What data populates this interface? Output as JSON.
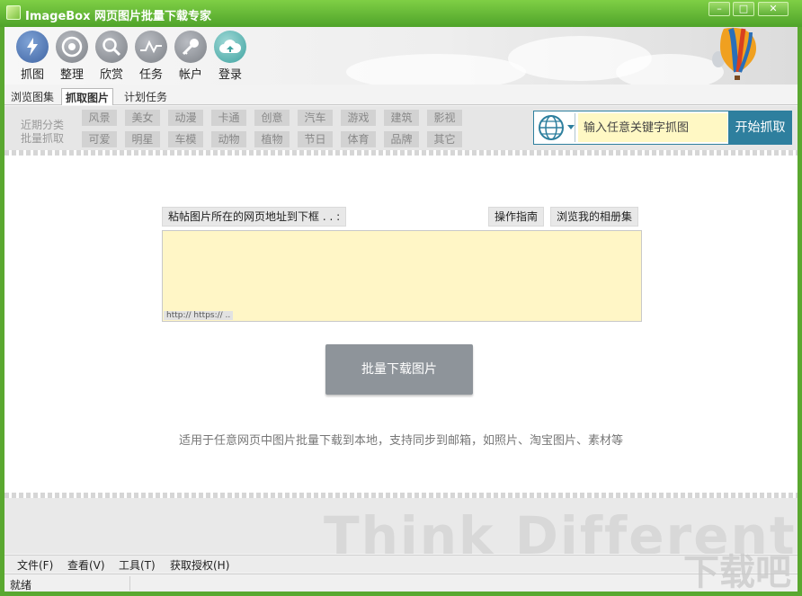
{
  "window": {
    "title": "ImageBox 网页图片批量下载专家",
    "controls": [
      "–",
      "□",
      "✕"
    ]
  },
  "toolbar": {
    "items": [
      {
        "label": "抓图",
        "icon": "lightning-icon"
      },
      {
        "label": "整理",
        "icon": "eye-icon"
      },
      {
        "label": "欣赏",
        "icon": "magnifier-icon"
      },
      {
        "label": "任务",
        "icon": "pulse-icon"
      },
      {
        "label": "帐户",
        "icon": "key-icon"
      },
      {
        "label": "登录",
        "icon": "cloud-upload-icon"
      }
    ]
  },
  "tabs": [
    "浏览图集",
    "抓取图片",
    "计划任务"
  ],
  "categories": {
    "label_line1": "近期分类",
    "label_line2": "批量抓取",
    "row1": [
      "风景",
      "美女",
      "动漫",
      "卡通",
      "创意",
      "汽车",
      "游戏",
      "建筑",
      "影视"
    ],
    "row2": [
      "可爱",
      "明星",
      "车模",
      "动物",
      "植物",
      "节日",
      "体育",
      "品牌",
      "其它"
    ]
  },
  "search": {
    "placeholder": "输入任意关键字抓图",
    "button": "开始抓取"
  },
  "main": {
    "paste_hint": "粘帖图片所在的网页地址到下框 . . :",
    "guide_button": "操作指南",
    "album_button": "浏览我的相册集",
    "url_hint": "http:// https:// ..",
    "download_button": "批量下载图片",
    "description": "适用于任意网页中图片批量下载到本地，支持同步到邮箱，如照片、淘宝图片、素材等"
  },
  "banner_text": "Think Different",
  "menu": [
    "文件(F)",
    "查看(V)",
    "工具(T)",
    "获取授权(H)"
  ],
  "status": "就绪",
  "watermark": "下载吧",
  "colors": {
    "title_bar": "#5aa830",
    "accent": "#2e7f9e",
    "input_bg": "#fff6c6",
    "download_button": "#8e949a"
  }
}
